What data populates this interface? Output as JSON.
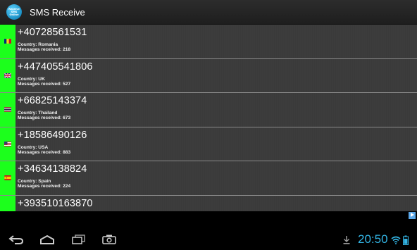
{
  "app": {
    "icon_text": [
      "Receive",
      "SMS",
      "Online"
    ],
    "title": "SMS Receive"
  },
  "numbers": [
    {
      "phone": "+40728561531",
      "country_line": "Country: Romania",
      "messages_line": "Messages received: 218",
      "flag": "romania-flag-icon"
    },
    {
      "phone": "+447405541806",
      "country_line": "Country: UK",
      "messages_line": "Messages received: 527",
      "flag": "uk-flag-icon"
    },
    {
      "phone": "+66825143374",
      "country_line": "Country: Thailand",
      "messages_line": "Messages received: 673",
      "flag": "thailand-flag-icon"
    },
    {
      "phone": "+18586490126",
      "country_line": "Country: USA",
      "messages_line": "Messages received: 883",
      "flag": "usa-flag-icon"
    },
    {
      "phone": "+34634138824",
      "country_line": "Country: Spain",
      "messages_line": "Messages received: 224",
      "flag": "spain-flag-icon"
    },
    {
      "phone": "+393510163870",
      "country_line": "",
      "messages_line": "",
      "flag": ""
    }
  ],
  "status_bar": {
    "time": "20:50"
  },
  "colors": {
    "flag_column": "#1cff1c",
    "clock": "#33b5e5"
  }
}
